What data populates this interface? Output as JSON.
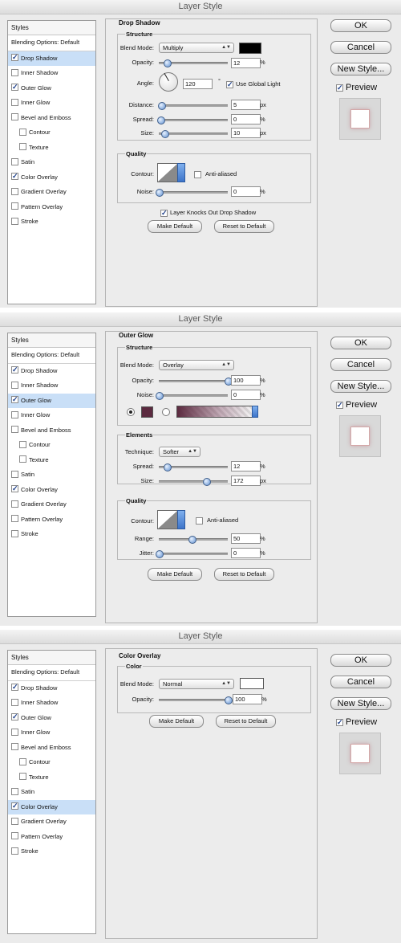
{
  "dialog_title": "Layer Style",
  "styles_header": "Styles",
  "style_items": [
    {
      "label": "Blending Options: Default",
      "checked": null,
      "sub": false
    },
    {
      "label": "Drop Shadow",
      "checked": true,
      "sub": false
    },
    {
      "label": "Inner Shadow",
      "checked": false,
      "sub": false
    },
    {
      "label": "Outer Glow",
      "checked": true,
      "sub": false
    },
    {
      "label": "Inner Glow",
      "checked": false,
      "sub": false
    },
    {
      "label": "Bevel and Emboss",
      "checked": false,
      "sub": false
    },
    {
      "label": "Contour",
      "checked": false,
      "sub": true
    },
    {
      "label": "Texture",
      "checked": false,
      "sub": true
    },
    {
      "label": "Satin",
      "checked": false,
      "sub": false
    },
    {
      "label": "Color Overlay",
      "checked": true,
      "sub": false
    },
    {
      "label": "Gradient Overlay",
      "checked": false,
      "sub": false
    },
    {
      "label": "Pattern Overlay",
      "checked": false,
      "sub": false
    },
    {
      "label": "Stroke",
      "checked": false,
      "sub": false
    }
  ],
  "buttons": {
    "ok": "OK",
    "cancel": "Cancel",
    "new_style": "New Style...",
    "preview": "Preview",
    "make_default": "Make Default",
    "reset_default": "Reset to Default"
  },
  "common": {
    "structure": "Structure",
    "quality": "Quality",
    "blend_mode": "Blend Mode:",
    "opacity": "Opacity:",
    "contour": "Contour:",
    "anti_aliased": "Anti-aliased",
    "pct": "%",
    "px": "px",
    "spread": "Spread:",
    "size": "Size:",
    "noise": "Noise:"
  },
  "drop_shadow": {
    "title": "Drop Shadow",
    "blend_mode": "Multiply",
    "color": "#000000",
    "opacity": "12",
    "angle_label": "Angle:",
    "angle": "120",
    "degree": "°",
    "use_global_light": "Use Global Light",
    "distance_label": "Distance:",
    "distance": "5",
    "spread": "0",
    "size": "10",
    "noise": "0",
    "knockout": "Layer Knocks Out Drop Shadow"
  },
  "outer_glow": {
    "title": "Outer Glow",
    "blend_mode": "Overlay",
    "opacity": "100",
    "noise": "0",
    "color": "#5b2a3f",
    "elements": "Elements",
    "technique_label": "Technique:",
    "technique": "Softer",
    "spread": "12",
    "size": "172",
    "range_label": "Range:",
    "range": "50",
    "jitter_label": "Jitter:",
    "jitter": "0"
  },
  "color_overlay": {
    "title": "Color Overlay",
    "group": "Color",
    "blend_mode": "Normal",
    "color": "#ffffff",
    "opacity": "100"
  }
}
